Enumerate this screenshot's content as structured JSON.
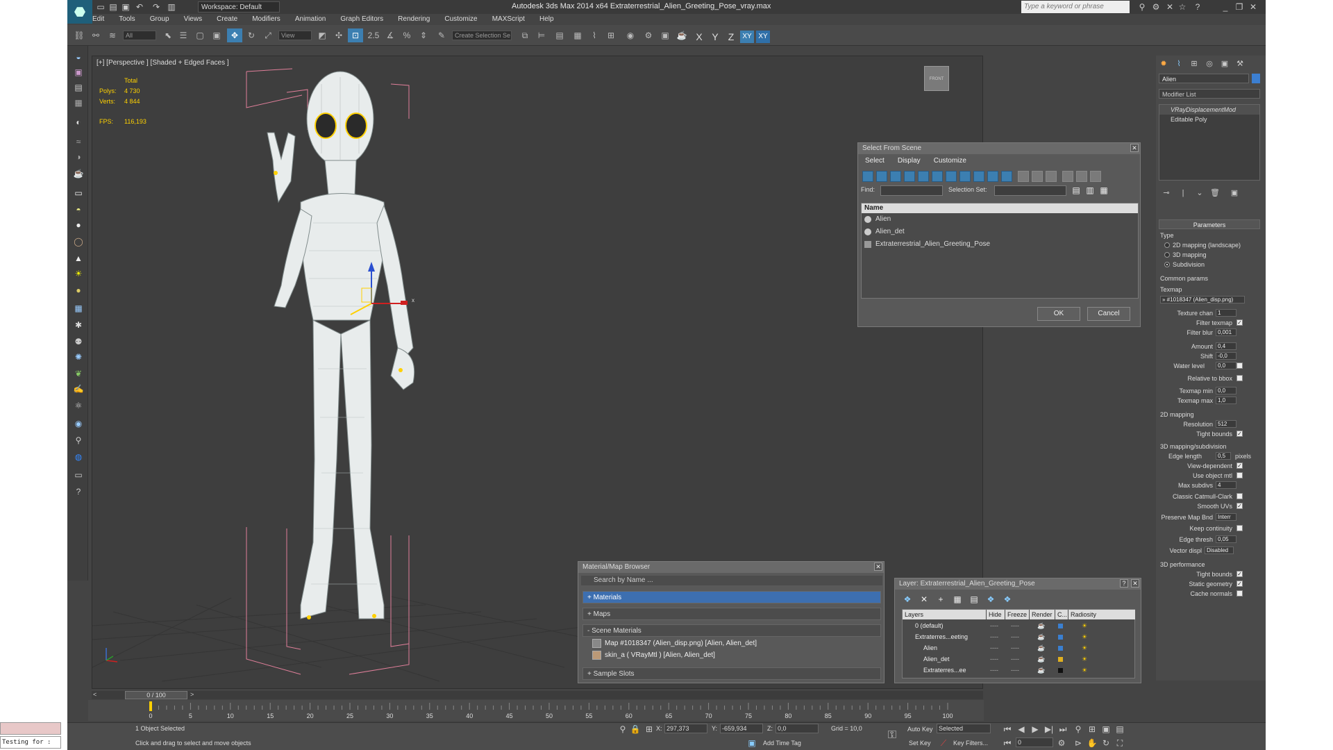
{
  "app": {
    "title": "Autodesk 3ds Max  2014 x64     Extraterrestrial_Alien_Greeting_Pose_vray.max",
    "workspace": "Workspace: Default",
    "search_placeholder": "Type a keyword or phrase"
  },
  "menu": [
    "Edit",
    "Tools",
    "Group",
    "Views",
    "Create",
    "Modifiers",
    "Animation",
    "Graph Editors",
    "Rendering",
    "Customize",
    "MAXScript",
    "Help"
  ],
  "toolbar": {
    "filter": "All",
    "refcoord": "View",
    "spinner_snap": "2.5",
    "angle_snap": "%",
    "create_selection_set": "Create Selection Se",
    "axes": [
      "X",
      "Y",
      "Z",
      "XY",
      "XY"
    ]
  },
  "viewport": {
    "label": "[+] [Perspective ] [Shaded + Edged Faces ]",
    "stats": {
      "total_label": "Total",
      "polys_label": "Polys:",
      "polys": "4 730",
      "verts_label": "Verts:",
      "verts": "4 844",
      "fps_label": "FPS:",
      "fps": "116,193"
    },
    "viewcube_label": "FRONT",
    "gizmo_x": "x"
  },
  "select_from_scene": {
    "title": "Select From Scene",
    "menus": [
      "Select",
      "Display",
      "Customize"
    ],
    "find_label": "Find:",
    "selection_set_label": "Selection Set:",
    "column": "Name",
    "rows": [
      "Alien",
      "Alien_det",
      "Extraterrestrial_Alien_Greeting_Pose"
    ],
    "ok": "OK",
    "cancel": "Cancel"
  },
  "material_browser": {
    "title": "Material/Map Browser",
    "search_placeholder": "Search by Name ...",
    "sections": [
      "+ Materials",
      "+ Maps",
      "- Scene Materials"
    ],
    "items": [
      "Map #1018347 (Alien_disp.png)  [Alien, Alien_det]",
      "skin_a  ( VRayMtl )  [Alien, Alien_det]"
    ],
    "sample_slots": "+ Sample Slots"
  },
  "layer_window": {
    "title": "Layer: Extraterrestrial_Alien_Greeting_Pose",
    "help_icon": "?",
    "headers": [
      "Layers",
      "Hide",
      "Freeze",
      "Render",
      "C...",
      "Radiosity"
    ],
    "rows": [
      "0 (default)",
      "Extraterres...eeting",
      "Alien",
      "Alien_det",
      "Extraterres...ee"
    ],
    "row_colors": [
      "#3a7fd0",
      "#3a7fd0",
      "#3a7fd0",
      "#e0b020",
      "#111111"
    ],
    "dash": "----"
  },
  "command_panel": {
    "object_name": "Alien",
    "modifier_list": "Modifier List",
    "stack": [
      "VRayDisplacementMod",
      "Editable Poly"
    ],
    "parameters_title": "Parameters",
    "type_label": "Type",
    "type_options": [
      "2D mapping (landscape)",
      "3D mapping",
      "Subdivision"
    ],
    "common_params": "Common params",
    "texmap_label": "Texmap",
    "texmap_value": "» #1018347 (Alien_disp.png)",
    "texture_chan": "Texture chan",
    "texture_chan_val": "1",
    "filter_texmap": "Filter texmap",
    "filter_blur": "Filter blur",
    "filter_blur_val": "0,001",
    "amount": "Amount",
    "amount_val": "0,4",
    "shift": "Shift",
    "shift_val": "-0,0",
    "water_level": "Water level",
    "water_level_val": "0,0",
    "relative_to_bbox": "Relative to bbox",
    "texmap_min": "Texmap min",
    "texmap_min_val": "0,0",
    "texmap_max": "Texmap max",
    "texmap_max_val": "1,0",
    "mapping_2d": "2D mapping",
    "resolution": "Resolution",
    "resolution_val": "512",
    "tight_bounds": "Tight bounds",
    "mapping_3d": "3D mapping/subdivision",
    "edge_length": "Edge length",
    "edge_length_val": "0,5",
    "pixels": "pixels",
    "view_dependent": "View-dependent",
    "use_object_mtl": "Use object mtl",
    "max_subdivs": "Max subdivs",
    "max_subdivs_val": "4",
    "classic_catmull": "Classic Catmull-Clark",
    "smooth_uvs": "Smooth UVs",
    "preserve_map_bnd": "Preserve Map Bnd",
    "preserve_map_bnd_val": "Interr",
    "keep_continuity": "Keep continuity",
    "edge_thresh": "Edge thresh",
    "edge_thresh_val": "0,05",
    "vector_displ": "Vector displ",
    "vector_displ_val": "Disabled",
    "perf_title": "3D performance",
    "perf_tight_bounds": "Tight bounds",
    "static_geometry": "Static geometry",
    "cache_normals": "Cache normals"
  },
  "timeline": {
    "frame_display": "0 / 100",
    "ticks": [
      "0",
      "5",
      "10",
      "15",
      "20",
      "25",
      "30",
      "35",
      "40",
      "45",
      "50",
      "55",
      "60",
      "65",
      "70",
      "75",
      "80",
      "85",
      "90",
      "95",
      "100"
    ]
  },
  "status": {
    "selection": "1 Object Selected",
    "prompt": "Click and drag to select and move objects",
    "x_label": "X:",
    "x": "297,373",
    "y_label": "Y:",
    "y": "-659,934",
    "z_label": "Z:",
    "z": "0,0",
    "grid": "Grid = 10,0",
    "add_time_tag": "Add Time Tag",
    "auto_key": "Auto Key",
    "selected": "Selected",
    "set_key": "Set Key",
    "key_filters": "Key Filters...",
    "frame": "0",
    "maxscript": "Testing for :"
  }
}
